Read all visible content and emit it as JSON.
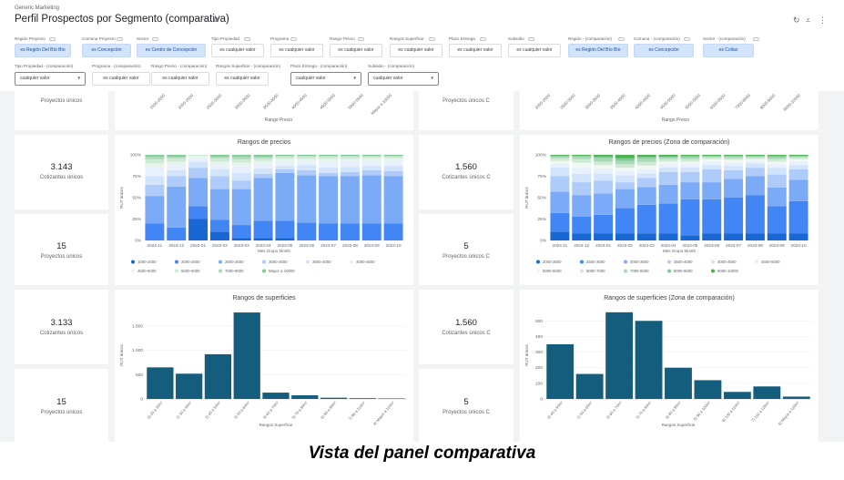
{
  "header": {
    "org": "Generic Marketing",
    "title": "Perfil Prospectos por Segmento (comparativa)",
    "title_icons": [
      "heart-icon",
      "copy-icon"
    ],
    "action_icons": [
      "refresh-icon",
      "filter-icon",
      "more-vert-icon"
    ]
  },
  "filters_row1": [
    {
      "label": "Región Proyecto",
      "value": "es Región Del Bío Bío",
      "selected": true
    },
    {
      "label": "Comuna Proyecto",
      "value": "es Concepción",
      "selected": true
    },
    {
      "label": "Sector",
      "value": "es Centro de Concepción",
      "selected": true
    },
    {
      "label": "Tipo Propiedad",
      "value": "es cualquier valor",
      "selected": false
    },
    {
      "label": "Programa",
      "value": "es cualquier valor",
      "selected": false
    },
    {
      "label": "Rango Precio",
      "value": "es cualquier valor",
      "selected": false
    },
    {
      "label": "Rangos Superficie",
      "value": "es cualquier valor",
      "selected": false
    },
    {
      "label": "Plazo Entrega",
      "value": "es cualquier valor",
      "selected": false
    },
    {
      "label": "Subsidio",
      "value": "es cualquier valor",
      "selected": false
    },
    {
      "label": "Región - (comparación)",
      "value": "es Región Del Bío Bío",
      "selected": true
    },
    {
      "label": "Comuna - (comparación)",
      "value": "es Concepción",
      "selected": true
    },
    {
      "label": "Sector - (comparación)",
      "value": "es Collao",
      "selected": true
    }
  ],
  "filters_row2": [
    {
      "label": "Tipo Propiedad - (comparación)",
      "value": "cualquier valor",
      "dropdown": true
    },
    {
      "label": "Programa - (comparación)",
      "value": "es cualquier valor",
      "dropdown": false
    },
    {
      "label": "Rango Precio - (comparación)",
      "value": "es cualquier valor",
      "dropdown": false
    },
    {
      "label": "Rangos Superficie - (comparación)",
      "value": "es cualquier valor",
      "dropdown": false
    },
    {
      "label": "Plazo Entrega - (comparación)",
      "value": "cualquier valor",
      "dropdown": true
    },
    {
      "label": "Subsidio - (comparación)",
      "value": "cualquier valor",
      "dropdown": true
    }
  ],
  "kpis": {
    "proyectos_unicos": "Proyectos únicos",
    "proyectos_unicos_c": "Proyectos únicos C",
    "cotizantes_unicos": "Cotizantes únicos",
    "cotizantes_unicos_c": "Cotizantes únicos C",
    "row1_val": "3.143",
    "row1_c_val": "1.560",
    "row2_val": "15",
    "row2_c_val": "5",
    "row3_val": "3.133",
    "row3_c_val": "1.560",
    "row4_val": "15",
    "row4_c_val": "5"
  },
  "caption": "Vista del panel comparativa",
  "chart_data": [
    {
      "id": "top-left-partial",
      "type": "bar",
      "xlabel": "Rango Precio",
      "categories": [
        "1500-2000",
        "2000-2500",
        "2500-3000",
        "3000-3500",
        "3500-4000",
        "4000-4500",
        "4500-5000",
        "5000-5500",
        "Mayor a 10000"
      ]
    },
    {
      "id": "top-right-partial",
      "type": "bar",
      "xlabel": "Rango Precio",
      "categories": [
        "2000-2500",
        "2500-3000",
        "3000-3500",
        "3500-4000",
        "4000-4500",
        "4500-5000",
        "5000-5500",
        "6000-6500",
        "7000-8000",
        "8000-9000",
        "9000-10000"
      ]
    },
    {
      "id": "rangos-precios",
      "type": "bar",
      "stacked": "percent",
      "title": "Rangos de precios",
      "xlabel": "Mes Grupo Month",
      "ylabel": "RUT únicos",
      "yticks": [
        "0%",
        "25%",
        "50%",
        "75%",
        "100%"
      ],
      "categories": [
        "2024-11",
        "2024-12",
        "2023-01",
        "2023-02",
        "2023-03",
        "2023-04",
        "2023-05",
        "2023-06",
        "2023-07",
        "2023-08",
        "2023-09",
        "2023-10"
      ],
      "legend": [
        "1000-2000",
        "2000-2500",
        "2500-3000",
        "3000-3500",
        "3500-4000",
        "4000-4500",
        "4500-5000",
        "5000-6000",
        "7000-8000",
        "Mayor a 10000"
      ],
      "colors": [
        "#1967d2",
        "#4285f4",
        "#7baaf7",
        "#aecbfa",
        "#d2e3fc",
        "#e8f0fe",
        "#e6f4ea",
        "#ceead6",
        "#a8dab5",
        "#81c995"
      ],
      "series": [
        {
          "name": "1000-2000",
          "values": [
            0,
            0,
            25,
            10,
            3,
            3,
            3,
            0,
            0,
            0,
            0,
            0
          ]
        },
        {
          "name": "2000-2500",
          "values": [
            20,
            15,
            15,
            14,
            15,
            20,
            20,
            21,
            20,
            20,
            20,
            20
          ]
        },
        {
          "name": "2500-3000",
          "values": [
            32,
            48,
            33,
            36,
            42,
            50,
            56,
            55,
            55,
            55,
            56,
            55
          ]
        },
        {
          "name": "3000-3500",
          "values": [
            13,
            12,
            12,
            15,
            10,
            5,
            4,
            6,
            4,
            5,
            6,
            6
          ]
        },
        {
          "name": "3500-4000",
          "values": [
            10,
            7,
            7,
            8,
            9,
            6,
            4,
            6,
            6,
            6,
            5,
            6
          ]
        },
        {
          "name": "4000-4500",
          "values": [
            10,
            6,
            5,
            5,
            8,
            5,
            5,
            4,
            7,
            7,
            6,
            6
          ]
        },
        {
          "name": "4500-5000",
          "values": [
            5,
            4,
            2,
            4,
            4,
            4,
            3,
            3,
            3,
            2,
            3,
            3
          ]
        },
        {
          "name": "5000-6000",
          "values": [
            5,
            4,
            1,
            4,
            4,
            3,
            3,
            3,
            3,
            3,
            2,
            2
          ]
        },
        {
          "name": "7000-8000",
          "values": [
            3,
            2,
            0,
            2,
            3,
            2,
            1,
            1,
            1,
            1,
            1,
            1
          ]
        },
        {
          "name": "Mayor a 10000",
          "values": [
            2,
            2,
            0,
            2,
            2,
            2,
            1,
            1,
            1,
            1,
            1,
            1
          ]
        }
      ]
    },
    {
      "id": "rangos-precios-comp",
      "type": "bar",
      "stacked": "percent",
      "title": "Rangos de precios (Zona de comparación)",
      "xlabel": "Mes Grupo Month",
      "ylabel": "RUT únicos",
      "yticks": [
        "0%",
        "25%",
        "50%",
        "75%",
        "100%"
      ],
      "categories": [
        "2024-11",
        "2024-12",
        "2023-01",
        "2023-02",
        "2023-03",
        "2023-04",
        "2023-05",
        "2023-06",
        "2023-07",
        "2023-08",
        "2023-09",
        "2023-10"
      ],
      "legend": [
        "2000-2500",
        "2500-3000",
        "3000-3500",
        "3500-4000",
        "4000-4500",
        "4500-5000",
        "5000-6000",
        "6000-7000",
        "7000-8000",
        "8000-9000",
        "9000-10000"
      ],
      "colors": [
        "#1967d2",
        "#4285f4",
        "#7baaf7",
        "#aecbfa",
        "#d2e3fc",
        "#e8f0fe",
        "#f1f8f1",
        "#ceead6",
        "#a8dab5",
        "#81c995",
        "#4caf50"
      ],
      "series": [
        {
          "name": "2000-2500",
          "values": [
            10,
            8,
            8,
            8,
            8,
            8,
            6,
            8,
            8,
            8,
            8,
            8
          ]
        },
        {
          "name": "2500-3000",
          "values": [
            22,
            20,
            22,
            30,
            32,
            35,
            42,
            40,
            42,
            45,
            32,
            38
          ]
        },
        {
          "name": "3000-3500",
          "values": [
            25,
            25,
            25,
            22,
            20,
            22,
            20,
            20,
            22,
            22,
            22,
            25
          ]
        },
        {
          "name": "3500-4000",
          "values": [
            18,
            15,
            15,
            8,
            10,
            15,
            12,
            15,
            10,
            10,
            15,
            12
          ]
        },
        {
          "name": "4000-4500",
          "values": [
            10,
            10,
            8,
            8,
            5,
            5,
            5,
            5,
            5,
            5,
            8,
            5
          ]
        },
        {
          "name": "4500-5000",
          "values": [
            5,
            7,
            6,
            5,
            5,
            4,
            4,
            4,
            4,
            3,
            4,
            4
          ]
        },
        {
          "name": "5000-6000",
          "values": [
            3,
            6,
            4,
            4,
            4,
            3,
            3,
            3,
            3,
            2,
            3,
            3
          ]
        },
        {
          "name": "6000-7000",
          "values": [
            3,
            4,
            4,
            4,
            4,
            3,
            3,
            2,
            2,
            2,
            3,
            2
          ]
        },
        {
          "name": "7000-8000",
          "values": [
            2,
            3,
            4,
            4,
            4,
            2,
            2,
            1,
            2,
            1,
            2,
            1
          ]
        },
        {
          "name": "8000-9000",
          "values": [
            1,
            1,
            2,
            3,
            2,
            1,
            2,
            1,
            1,
            1,
            2,
            1
          ]
        },
        {
          "name": "9000-10000",
          "values": [
            1,
            1,
            2,
            4,
            2,
            2,
            1,
            1,
            1,
            1,
            1,
            1
          ]
        }
      ]
    },
    {
      "id": "rangos-superficies",
      "type": "bar",
      "title": "Rangos de superficies",
      "xlabel": "Rangos Superficie",
      "ylabel": "RUT únicos",
      "yticks": [
        "0",
        "500",
        "1.000",
        "1.500"
      ],
      "ylim": [
        0,
        1800
      ],
      "color": "#145d7c",
      "categories": [
        "0) 20 a 30m²",
        "1) 30 a 40m²",
        "2) 40 a 50m²",
        "3) 50 a 60m²",
        "4) 60 a 70m²",
        "5) 70 a 80m²",
        "6) 80 a 90m²",
        "7) 90 a 110m²",
        "8) Mayor a 110m²"
      ],
      "values": [
        650,
        520,
        920,
        1780,
        130,
        75,
        25,
        15,
        10
      ]
    },
    {
      "id": "rangos-superficies-comp",
      "type": "bar",
      "title": "Rangos de superficies (Zona de comparación)",
      "xlabel": "Rangos Superficie",
      "ylabel": "RUT únicos",
      "yticks": [
        "0",
        "100",
        "200",
        "300",
        "400",
        "500"
      ],
      "ylim": [
        0,
        560
      ],
      "color": "#145d7c",
      "categories": [
        "0) 40 a 50m²",
        "1) 50 a 60m²",
        "2) 60 a 70m²",
        "3) 70 a 80m²",
        "4) 80 a 90m²",
        "5) 90 a 100m²",
        "6) 100 a 110m²",
        "7) 110 a 120m²",
        "8) Mayor a 120m²"
      ],
      "values": [
        350,
        160,
        555,
        500,
        200,
        120,
        45,
        80,
        15
      ]
    }
  ]
}
